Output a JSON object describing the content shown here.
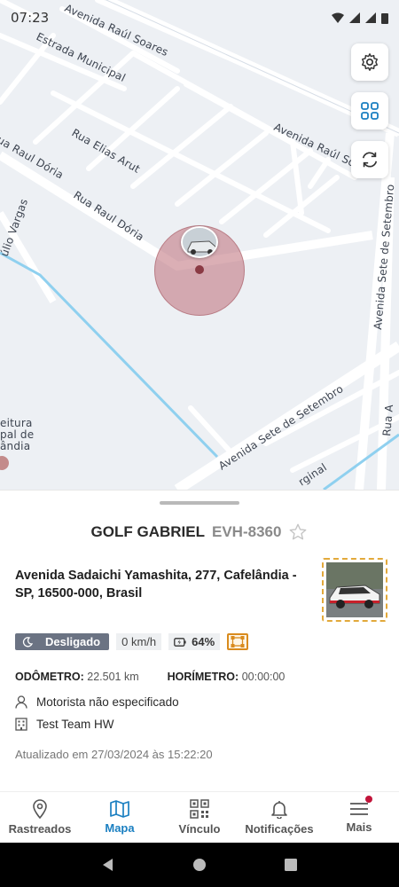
{
  "status_bar": {
    "time": "07:23"
  },
  "map": {
    "streets": {
      "avenida_raul_soares_top": "Avenida Raúl Soares",
      "estrada_municipal": "Estrada Municipal",
      "rua_elias_arut": "Rua Elias Arut",
      "avenida_raul_soares_right": "Avenida Raúl So",
      "rua_raul_doria_left": "ua Raul Dória",
      "rua_raul_doria": "Rua Raul Dória",
      "tulio_vargas": "úlio Vargas",
      "avenida_sete_setembro_vertical": "Avenida Sete de Setembro",
      "avenida_sete_setembro_diag": "Avenida Sete de Setembro",
      "rua_a": "Rua A",
      "rginal": "rginal",
      "poi_line1": "eitura",
      "poi_line2": "pal de",
      "poi_line3": "ândia"
    },
    "buttons": {
      "settings_icon": "gear-icon",
      "layers_icon": "grid-icon",
      "refresh_icon": "refresh-icon"
    }
  },
  "vehicle": {
    "name": "GOLF GABRIEL",
    "plate": "EVH-8360",
    "address": "Avenida Sadaichi Yamashita, 277, Cafelândia - SP, 16500-000, Brasil",
    "status": "Desligado",
    "speed": "0 km/h",
    "battery": "64%",
    "odometer_label": "ODÔMETRO:",
    "odometer_value": "22.501 km",
    "hourmeter_label": "HORÍMETRO:",
    "hourmeter_value": "00:00:00",
    "driver": "Motorista não especificado",
    "team": "Test Team HW",
    "updated": "Atualizado em 27/03/2024 às 15:22:20"
  },
  "nav": [
    {
      "label": "Rastreados",
      "icon": "location-pin-icon"
    },
    {
      "label": "Mapa",
      "icon": "map-icon",
      "active": true
    },
    {
      "label": "Vínculo",
      "icon": "qr-code-icon"
    },
    {
      "label": "Notificações",
      "icon": "bell-icon"
    },
    {
      "label": "Mais",
      "icon": "menu-icon",
      "badge": true
    }
  ],
  "colors": {
    "accent": "#1a7fc1",
    "status_off": "#6b7383",
    "badge": "#c2143a",
    "geofence": "#d98b1e"
  }
}
